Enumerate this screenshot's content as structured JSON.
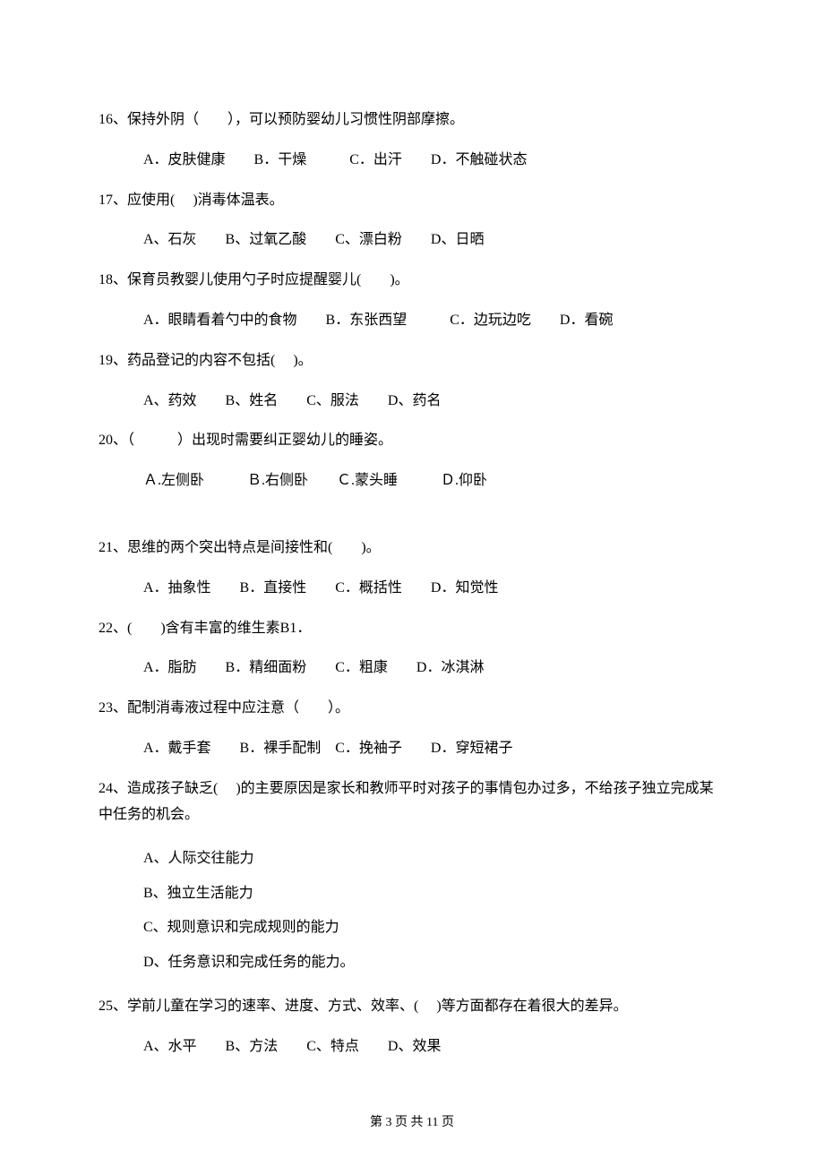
{
  "q16": {
    "stem": "16、保持外阴（　　），可以预防婴幼儿习惯性阴部摩擦。",
    "opts": "A．皮肤健康　　B．干燥　　　C．出汗　　D．不触碰状态"
  },
  "q17": {
    "stem": "17、应使用(　 )消毒体温表。",
    "opts": "A、石灰　　B、过氧乙酸　　C、漂白粉　　D、日晒"
  },
  "q18": {
    "stem": "18、保育员教婴儿使用勺子时应提醒婴儿(　　)。",
    "opts": "A．眼睛看着勺中的食物　　B．东张西望　　　C．边玩边吃　　D．看碗"
  },
  "q19": {
    "stem": "19、药品登记的内容不包括(　 )。",
    "opts": "A、药效　　B、姓名　　C、服法　　D、药名"
  },
  "q20": {
    "stem": "20、（　　　）出现时需要纠正婴幼儿的睡姿。",
    "opts": "Ａ.左侧卧　　　Ｂ.右侧卧　　Ｃ.蒙头睡　　　Ｄ.仰卧"
  },
  "q21": {
    "stem": "21、思维的两个突出特点是间接性和(　　)。",
    "opts": "A．抽象性　　B．直接性　　C．概括性　　D．知觉性"
  },
  "q22": {
    "stem": "22、(　　)含有丰富的维生素B1．",
    "opts": "A．脂肪　　B．精细面粉　　C．粗康　　D．冰淇淋"
  },
  "q23": {
    "stem": "23、配制消毒液过程中应注意（　　）。",
    "opts": "A．戴手套　　B．裸手配制　C．挽袖子　　D．穿短裙子"
  },
  "q24": {
    "stem": "24、造成孩子缺乏(　 )的主要原因是家长和教师平时对孩子的事情包办过多，不给孩子独立完成某中任务的机会。",
    "optA": "A、人际交往能力",
    "optB": "B、独立生活能力",
    "optC": "C、规则意识和完成规则的能力",
    "optD": "D、任务意识和完成任务的能力。"
  },
  "q25": {
    "stem": "25、学前儿童在学习的速率、进度、方式、效率、(　 )等方面都存在着很大的差异。",
    "opts": "A、水平　　B、方法　　C、特点　　D、效果"
  },
  "footer": "第 3 页 共 11 页"
}
